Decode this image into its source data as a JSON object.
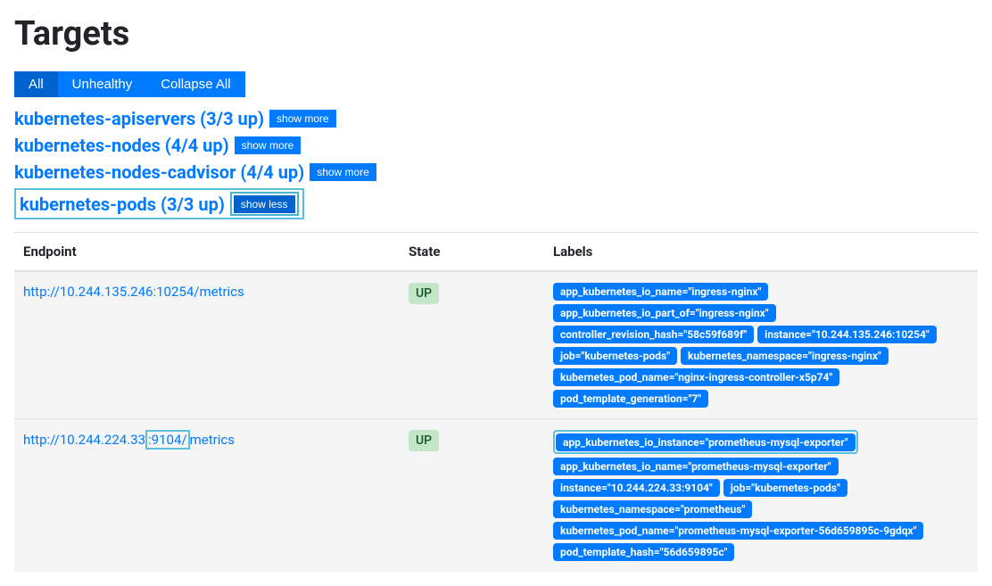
{
  "page_title": "Targets",
  "filters": {
    "all": "All",
    "unhealthy": "Unhealthy",
    "collapse_all": "Collapse All"
  },
  "groups": [
    {
      "title": "kubernetes-apiservers (3/3 up)",
      "toggle": "show more"
    },
    {
      "title": "kubernetes-nodes (4/4 up)",
      "toggle": "show more"
    },
    {
      "title": "kubernetes-nodes-cadvisor (4/4 up)",
      "toggle": "show more"
    },
    {
      "title": "kubernetes-pods (3/3 up)",
      "toggle": "show less"
    }
  ],
  "table": {
    "headers": {
      "endpoint": "Endpoint",
      "state": "State",
      "labels": "Labels"
    },
    "rows": [
      {
        "endpoint": "http://10.244.135.246:10254/metrics",
        "state": "UP",
        "labels": [
          "app_kubernetes_io_name=\"ingress-nginx\"",
          "app_kubernetes_io_part_of=\"ingress-nginx\"",
          "controller_revision_hash=\"58c59f689f\"",
          "instance=\"10.244.135.246:10254\"",
          "job=\"kubernetes-pods\"",
          "kubernetes_namespace=\"ingress-nginx\"",
          "kubernetes_pod_name=\"nginx-ingress-controller-x5p74\"",
          "pod_template_generation=\"7\""
        ]
      },
      {
        "endpoint_pre": "http://10.244.224.33",
        "endpoint_highlight": ":9104/",
        "endpoint_post": "metrics",
        "state": "UP",
        "labels": [
          "app_kubernetes_io_instance=\"prometheus-mysql-exporter\"",
          "app_kubernetes_io_name=\"prometheus-mysql-exporter\"",
          "instance=\"10.244.224.33:9104\"",
          "job=\"kubernetes-pods\"",
          "kubernetes_namespace=\"prometheus\"",
          "kubernetes_pod_name=\"prometheus-mysql-exporter-56d659895c-9gdqx\"",
          "pod_template_hash=\"56d659895c\""
        ]
      }
    ]
  }
}
